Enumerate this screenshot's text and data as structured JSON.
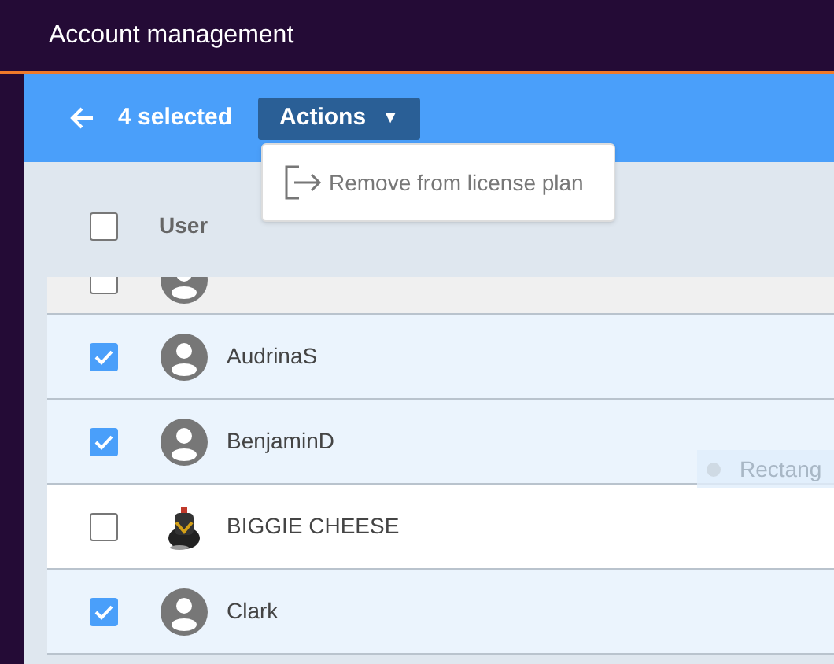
{
  "app_bar": {
    "title": "Account management"
  },
  "selection_bar": {
    "count": "4 selected",
    "actions_button": "Actions",
    "caret": "▼"
  },
  "actions_menu": {
    "items": [
      {
        "label": "Remove from license plan"
      }
    ]
  },
  "table": {
    "columns": [
      "User"
    ],
    "header_checked": false,
    "rows": [
      {
        "kind": "default",
        "selected": false,
        "partial": true
      },
      {
        "name": "AudrinaS",
        "kind": "default",
        "selected": true
      },
      {
        "name": "BenjaminD",
        "kind": "default",
        "selected": true
      },
      {
        "name": "BIGGIE CHEESE",
        "kind": "picture",
        "selected": false
      },
      {
        "name": "Clark",
        "kind": "default",
        "selected": true
      }
    ]
  },
  "drag_ghost": {
    "label": "Rectang"
  }
}
